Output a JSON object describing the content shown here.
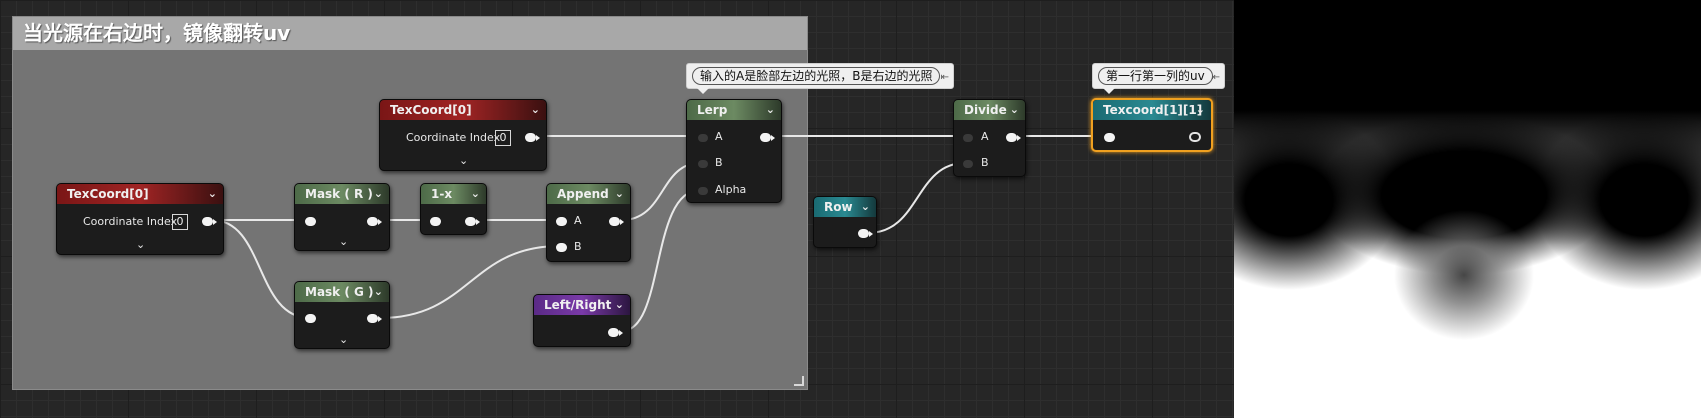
{
  "comment": {
    "title": "当光源在右边时，镜像翻转uv"
  },
  "nodes": {
    "texcoord_a": {
      "title": "TexCoord[0]",
      "pin_label": "Coordinate Index",
      "index": "0"
    },
    "texcoord_b": {
      "title": "TexCoord[0]",
      "pin_label": "Coordinate Index",
      "index": "0"
    },
    "mask_r": {
      "title": "Mask ( R )"
    },
    "mask_g": {
      "title": "Mask ( G )"
    },
    "one_minus_x": {
      "title": "1-x"
    },
    "append": {
      "title": "Append",
      "pin_a": "A",
      "pin_b": "B"
    },
    "left_right": {
      "title": "Left/Right"
    },
    "lerp": {
      "title": "Lerp",
      "pin_a": "A",
      "pin_b": "B",
      "pin_alpha": "Alpha",
      "comment": "输入的A是脸部左边的光照，B是右边的光照"
    },
    "row": {
      "title": "Row"
    },
    "divide": {
      "title": "Divide",
      "pin_a": "A",
      "pin_b": "B"
    },
    "texcoord_out": {
      "title": "Texcoord[1][1]",
      "comment": "第一行第一列的uv"
    }
  },
  "colors": {
    "comment_bg": "#747474",
    "red_header": "#a02424",
    "green_header": "#6c8a62",
    "teal_header": "#2a8a92",
    "purple_header": "#7a3aa8",
    "selection": "#f0a020"
  },
  "icons": {
    "expand": "chevron-down-icon",
    "comment_pin": "pin-icon",
    "resize": "resize-grip-icon"
  }
}
